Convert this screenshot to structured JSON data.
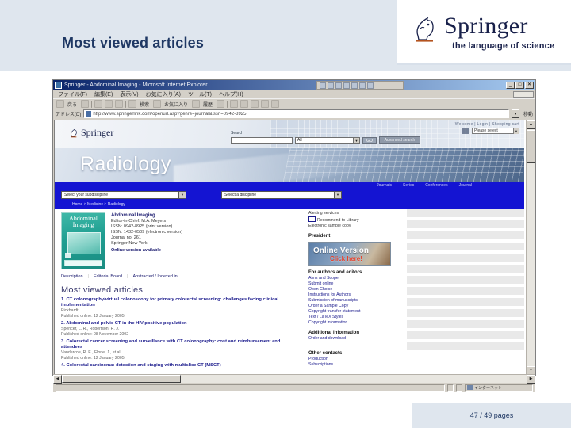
{
  "slide": {
    "title": "Most viewed articles",
    "footer_text": "47 / 49 pages"
  },
  "brand": {
    "name": "Springer",
    "tagline": "the language of science",
    "logo_icon": "springer-knight-icon"
  },
  "browser": {
    "title": "Springer - Abdominal Imaging - Microsoft Internet Explorer",
    "title_icon": "ie-document-icon",
    "window_controls": {
      "minimize": "_",
      "maximize": "□",
      "close": "✕"
    },
    "menu": [
      "ファイル(F)",
      "編集(E)",
      "表示(V)",
      "お気に入り(A)",
      "ツール(T)",
      "ヘルプ(H)"
    ],
    "toolbar": {
      "back_label": "戻る",
      "forward_label": "",
      "search_label": "検索",
      "favorites_label": "お気に入り",
      "history_label": "履歴",
      "icons": [
        "back-icon",
        "forward-icon",
        "stop-icon",
        "refresh-icon",
        "home-icon",
        "search-icon",
        "favorites-icon",
        "history-icon",
        "mail-icon",
        "print-icon",
        "edit-icon",
        "discuss-icon"
      ]
    },
    "address": {
      "label": "アドレス(D)",
      "url": "http://www.springerlink.com/openurl.asp?genre=journal&issn=0942-8925",
      "go_label": "移動",
      "favicon": "page-icon"
    },
    "status": {
      "zone_text": "インターネット",
      "zone_icon": "internet-zone-icon"
    }
  },
  "site": {
    "logo_word": "Springer",
    "top_links": "Welcome  |  Login  |  Shopping cart",
    "country_select": "Please select",
    "cart_icon": "shopping-cart-icon",
    "search": {
      "label": "Search",
      "value": "",
      "category": "All",
      "go_label": "GO",
      "advanced_label": "Advanced search"
    },
    "banner_title": "Radiology",
    "nav_links": [
      "Journals",
      "Series",
      "Conferences",
      "Journal"
    ],
    "discipline_select": "Select your subdiscipline",
    "subdiscipline_select": "Select a discipline",
    "breadcrumb": "Home > Medicine > Radiology"
  },
  "journal": {
    "cover_title": "Abdominal Imaging",
    "cover_alt": "abdominal-imaging-cover",
    "title": "Abdominal Imaging",
    "editor": "Editor-in-Chief: M.A. Meyers",
    "issn_print": "ISSN: 0942-8925 (print version)",
    "issn_electronic": "ISSN: 1432-0509 (electronic version)",
    "journal_no": "Journal no. 261",
    "publisher": "Springer New York",
    "online_note": "Online version available",
    "tabs": [
      "Description",
      "Editorial Board",
      "Abstracted / Indexed in"
    ]
  },
  "articles": {
    "heading": "Most viewed articles",
    "items": [
      {
        "title": "1. CT colonography/virtual colonoscopy for primary colorectal screening: challenges facing clinical implementation",
        "authors": "Pickhardt, ...",
        "published": "Published online: 12 January 2005"
      },
      {
        "title": "2. Abdominal and pelvic CT in the HIV-positive population",
        "authors": "Spencer, L. R., Robertson, R. J.",
        "published": "Published online: 08 November 2002"
      },
      {
        "title": "3. Colorectal cancer screening and surveillance with CT colonography: cost and reimbursement and attendees",
        "authors": "Vandercoe, R. E., Florie, J., et al.",
        "published": "Published online: 12 January 2005"
      },
      {
        "title": "4. Colorectal carcinoma: detection and staging with multislice CT (MSCT)",
        "authors": "",
        "published": ""
      }
    ]
  },
  "sidebar": {
    "alerts_line": "Alerting services",
    "recommend": "Recommend to Library",
    "electronic_copy": "Electronic sample copy",
    "president_head": "President",
    "promo_line_1": "Online Version",
    "promo_line_2": "Click here!",
    "authors_head": "For authors and editors",
    "authors_links": [
      "Aims and Scope",
      "Submit online",
      "Open Choice",
      "Instructions for Authors",
      "Submission of manuscripts",
      "Order a Sample Copy",
      "Copyright transfer statement",
      "Text / LaTeX Styles",
      "Copyright information"
    ],
    "additional_head": "Additional information",
    "additional_links": [
      "Order and download"
    ],
    "contacts_head": "Other contacts",
    "contacts_links": [
      "Production",
      "Subscriptions"
    ]
  }
}
